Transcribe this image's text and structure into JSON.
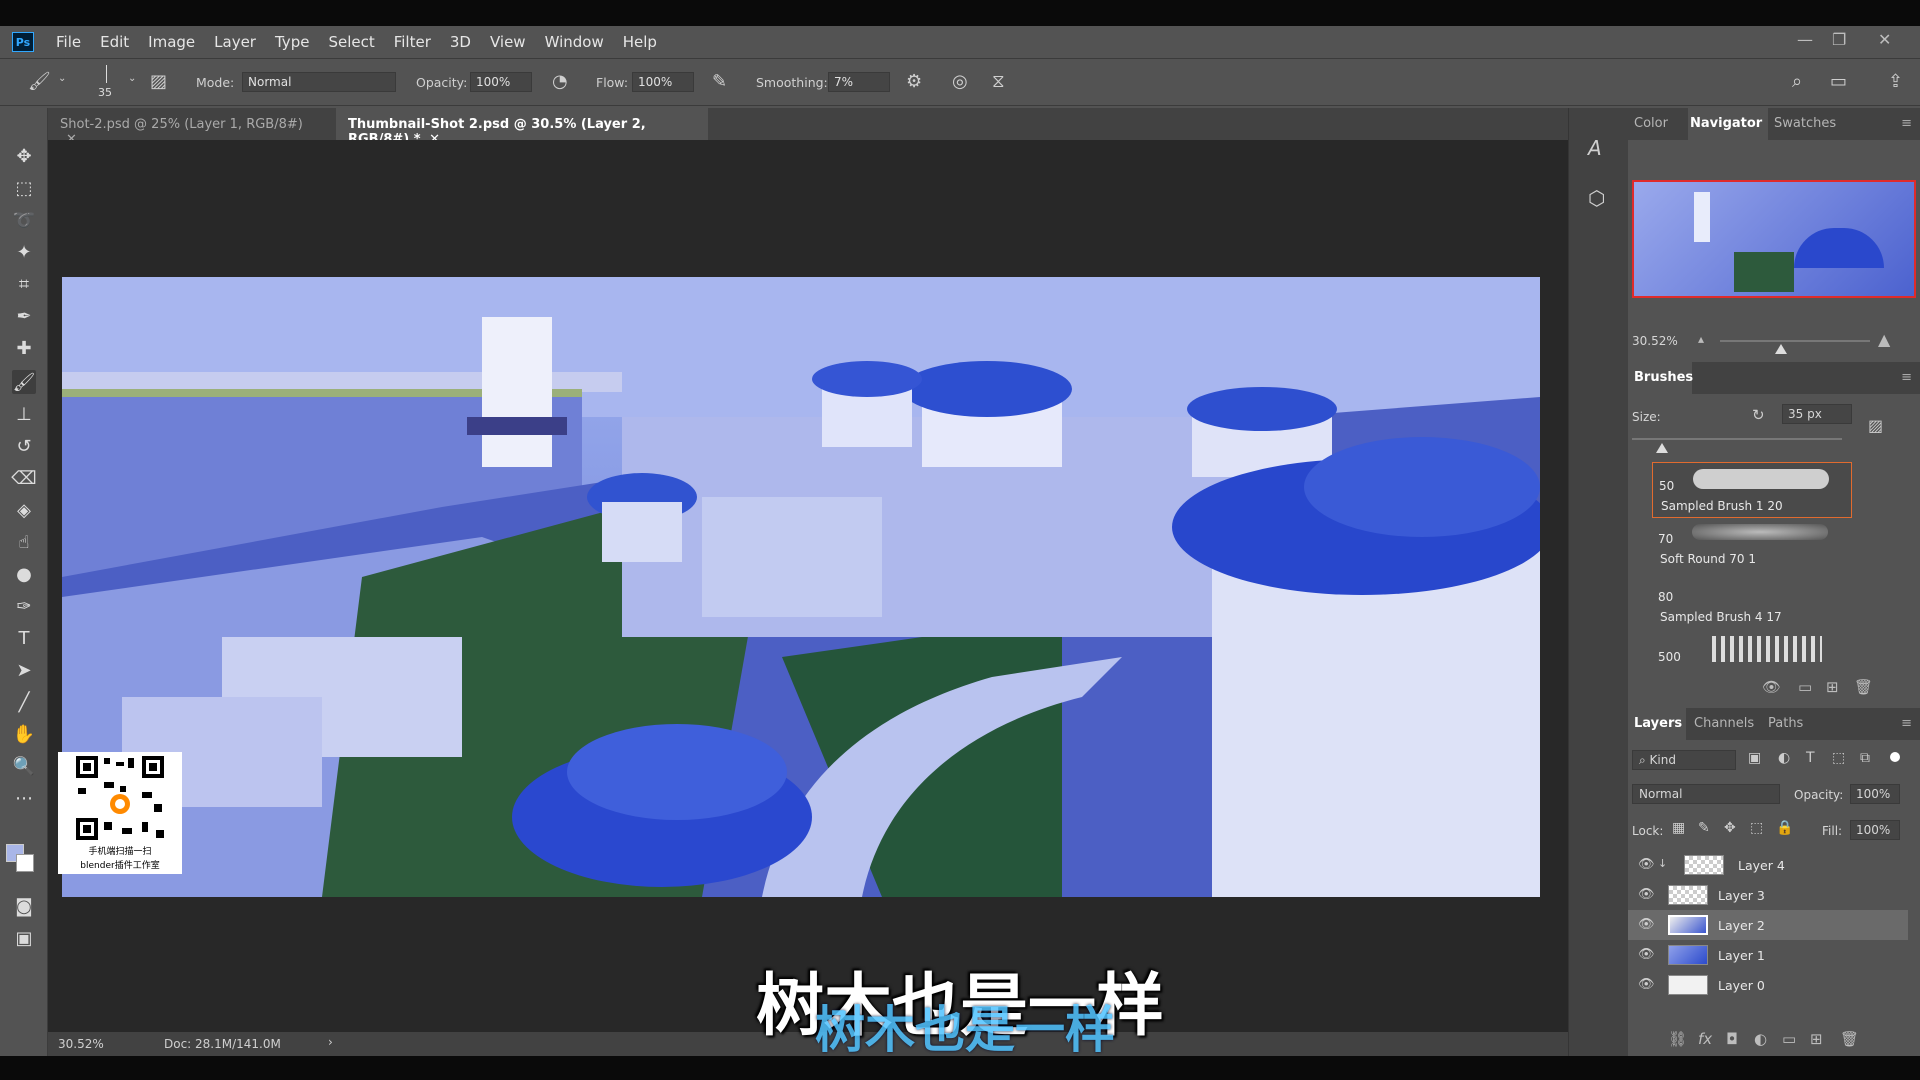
{
  "app": {
    "logo": "Ps"
  },
  "menu": [
    "File",
    "Edit",
    "Image",
    "Layer",
    "Type",
    "Select",
    "Filter",
    "3D",
    "View",
    "Window",
    "Help"
  ],
  "options": {
    "brush_size": "35",
    "mode_label": "Mode:",
    "mode_value": "Normal",
    "opacity_label": "Opacity:",
    "opacity_value": "100%",
    "flow_label": "Flow:",
    "flow_value": "100%",
    "smoothing_label": "Smoothing:",
    "smoothing_value": "7%"
  },
  "tabs": [
    {
      "label": "Shot-2.psd @ 25% (Layer 1, RGB/8#)",
      "active": false
    },
    {
      "label": "Thumbnail-Shot 2.psd @ 30.5% (Layer 2, RGB/8#) *",
      "active": true
    }
  ],
  "status": {
    "zoom": "30.52%",
    "doc": "Doc: 28.1M/141.0M"
  },
  "qr": {
    "line1": "手机端扫描一扫",
    "line2": "blender插件工作室"
  },
  "navigator": {
    "tabs": [
      "Color",
      "Navigator",
      "Swatches"
    ],
    "active": "Navigator",
    "zoom": "30.52%"
  },
  "brushes": {
    "title": "Brushes",
    "size_label": "Size:",
    "size_value": "35 px",
    "items": [
      {
        "size": "50",
        "name": "Sampled Brush 1 20"
      },
      {
        "size": "70",
        "name": "Soft Round 70 1"
      },
      {
        "size": "80",
        "name": "Sampled Brush 4 17"
      },
      {
        "size": "500",
        "name": ""
      }
    ]
  },
  "layers": {
    "tabs": [
      "Layers",
      "Channels",
      "Paths"
    ],
    "active": "Layers",
    "kind_label": "Kind",
    "blend": "Normal",
    "opacity_label": "Opacity:",
    "opacity_value": "100%",
    "lock_label": "Lock:",
    "fill_label": "Fill:",
    "fill_value": "100%",
    "rows": [
      {
        "name": "Layer 4",
        "selected": false
      },
      {
        "name": "Layer 3",
        "selected": false
      },
      {
        "name": "Layer 2",
        "selected": true
      },
      {
        "name": "Layer 1",
        "selected": false
      },
      {
        "name": "Layer 0",
        "selected": false
      }
    ]
  },
  "subtitle": "树木也是一样",
  "subtitle_overlay": "树木也是一样",
  "colors": {
    "accent": "#31a8ff",
    "canvas_blue": "#2c4fd0"
  }
}
